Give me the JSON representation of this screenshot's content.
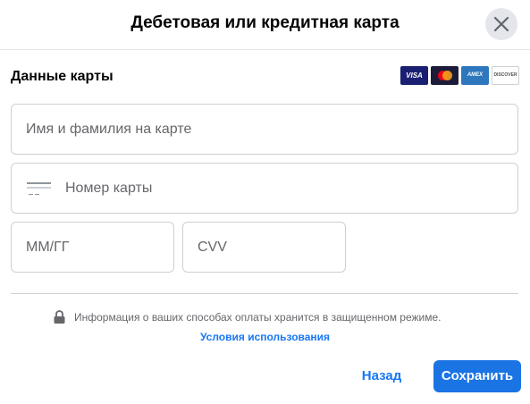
{
  "dialog": {
    "title": "Дебетовая или кредитная карта",
    "close_icon": "close-icon"
  },
  "card_section": {
    "title": "Данные карты",
    "logos": [
      {
        "icon": "visa-logo",
        "text": "VISA",
        "color": "#1a1f71"
      },
      {
        "icon": "mastercard-logo",
        "color": "#eb001b"
      },
      {
        "icon": "amex-logo",
        "text": "AMEX",
        "color": "#2e77bc"
      },
      {
        "icon": "discover-logo",
        "text": "DISCOVER",
        "color": "#ffffff"
      }
    ]
  },
  "form": {
    "name_placeholder": "Имя и фамилия на карте",
    "name_value": "",
    "card_placeholder": "Номер карты",
    "card_value": "",
    "card_icon": "credit-card-icon",
    "expiry_placeholder": "ММ/ГГ",
    "expiry_value": "",
    "cvv_placeholder": "CVV",
    "cvv_value": ""
  },
  "footer": {
    "secure_icon": "lock-icon",
    "secure_text": "Информация о ваших способах оплаты хранится в защищенном режиме.",
    "terms_link": "Условия использования",
    "back_label": "Назад",
    "save_label": "Сохранить"
  },
  "colors": {
    "accent": "#1b74e4",
    "link": "#1877f2",
    "border": "#ccd0d5",
    "muted_text": "#65676b"
  }
}
